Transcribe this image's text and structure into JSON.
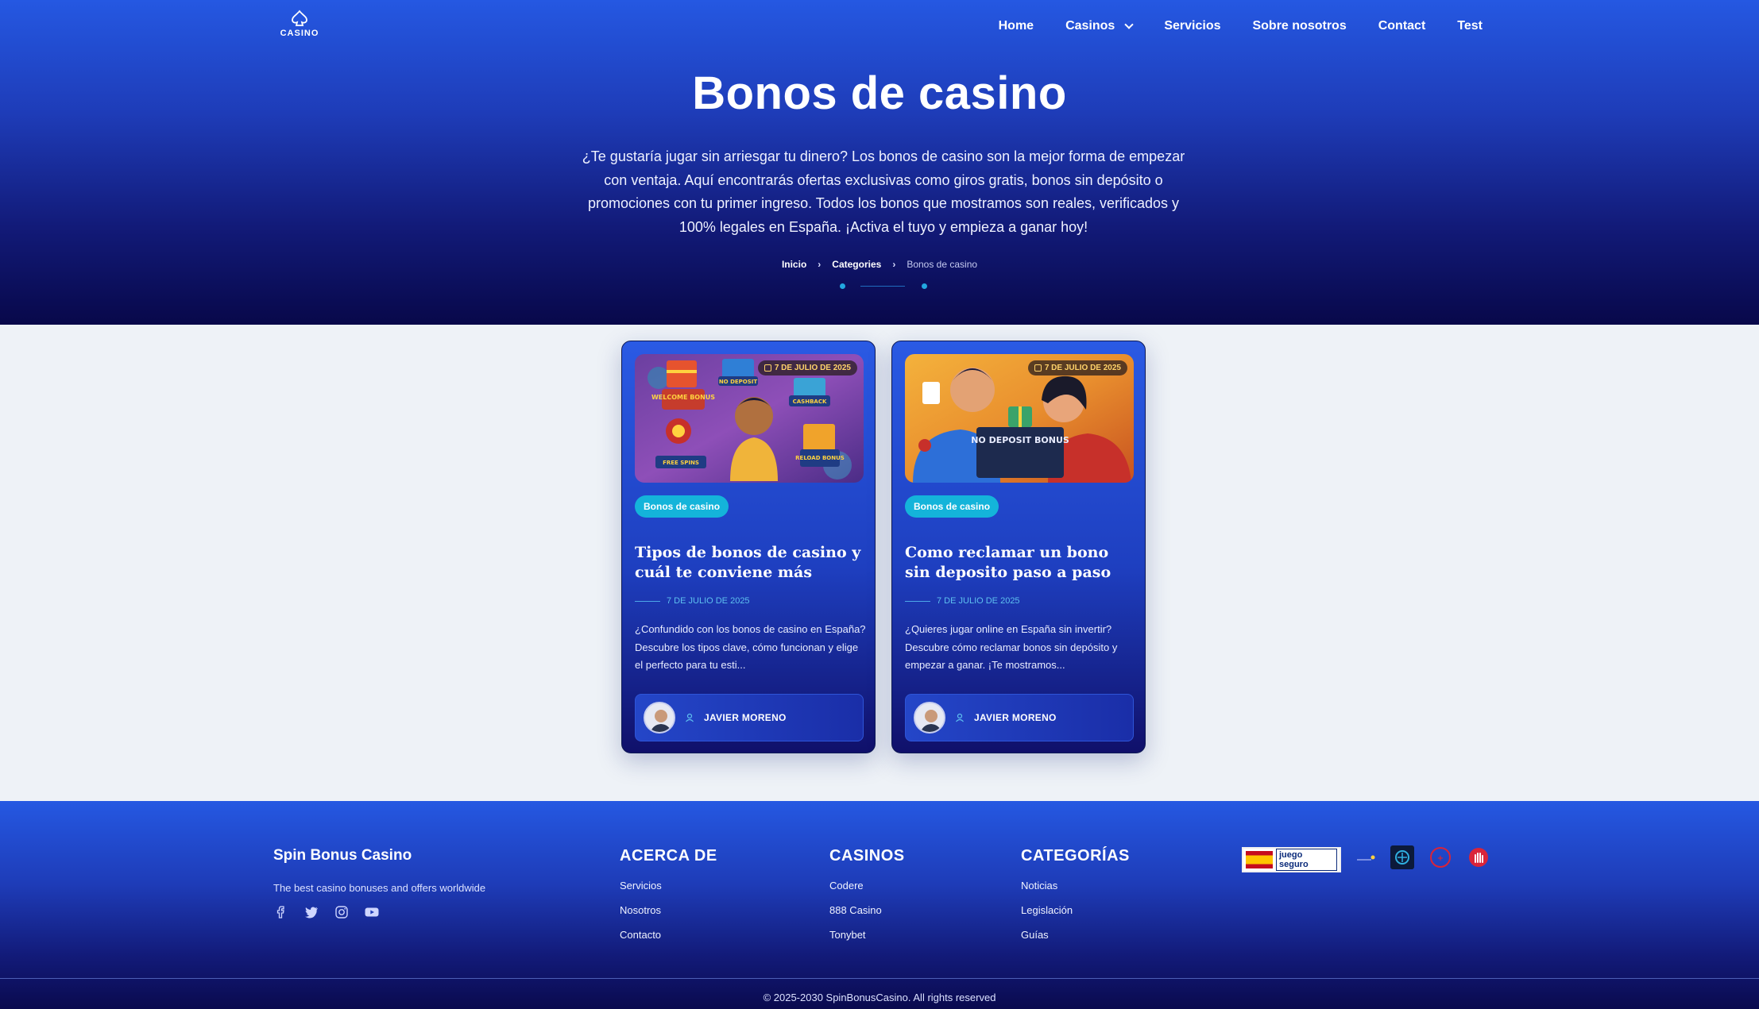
{
  "header": {
    "logo_text": "CASINO",
    "nav": [
      {
        "label": "Home"
      },
      {
        "label": "Casinos"
      },
      {
        "label": "Servicios"
      },
      {
        "label": "Sobre nosotros"
      },
      {
        "label": "Contact"
      },
      {
        "label": "Test"
      }
    ]
  },
  "hero": {
    "title": "Bonos de casino",
    "description": "¿Te gustaría jugar sin arriesgar tu dinero? Los bonos de casino son la mejor forma de empezar con ventaja. Aquí encontrarás ofertas exclusivas como giros gratis, bonos sin depósito o promociones con tu primer ingreso. Todos los bonos que mostramos son reales, verificados y 100% legales en España. ¡Activa el tuyo y empieza a ganar hoy!",
    "breadcrumb": [
      "Inicio",
      "Categories",
      "Bonos de casino"
    ]
  },
  "posts": [
    {
      "date_chip": "7 DE JULIO DE 2025",
      "image_labels": [
        "WELCOME BONUS",
        "NO DEPOSIT",
        "CASHBACK",
        "FREE SPINS",
        "RELOAD BONUS"
      ],
      "tag": "Bonos de casino",
      "title": "Tipos de bonos de casino y cuál te conviene más",
      "date": "7 DE JULIO DE 2025",
      "excerpt": "¿Confundido con los bonos de casino en España? Descubre los tipos clave, cómo funcionan y elige el perfecto para tu esti...",
      "author": "JAVIER MORENO"
    },
    {
      "date_chip": "7 DE JULIO DE 2025",
      "image_labels": [
        "NO DEPOSIT BONUS"
      ],
      "tag": "Bonos de casino",
      "title": "Como reclamar un bono sin deposito paso a paso",
      "date": "7 DE JULIO DE 2025",
      "excerpt": "¿Quieres jugar online en España sin invertir? Descubre cómo reclamar bonos sin depósito y empezar a ganar. ¡Te mostramos...",
      "author": "JAVIER MORENO"
    }
  ],
  "footer": {
    "brand": "Spin Bonus Casino",
    "tagline": "The best casino bonuses and offers worldwide",
    "social": [
      "facebook-icon",
      "twitter-icon",
      "instagram-icon",
      "youtube-icon"
    ],
    "columns": [
      {
        "heading": "ACERCA DE",
        "links": [
          "Servicios",
          "Nosotros",
          "Contacto"
        ]
      },
      {
        "heading": "CASINOS",
        "links": [
          "Codere",
          "888 Casino",
          "Tonybet"
        ]
      },
      {
        "heading": "CATEGORÍAS",
        "links": [
          "Noticias",
          "Legislación",
          "Guías"
        ]
      }
    ],
    "badges": {
      "juego_seguro": "juego seguro"
    },
    "copyright": "© 2025-2030 SpinBonusCasino. All rights reserved"
  },
  "colors": {
    "hero_top": "#2558e2",
    "hero_bottom": "#08084a",
    "tag": "#14b4da",
    "page_bg": "#eef2f7"
  }
}
